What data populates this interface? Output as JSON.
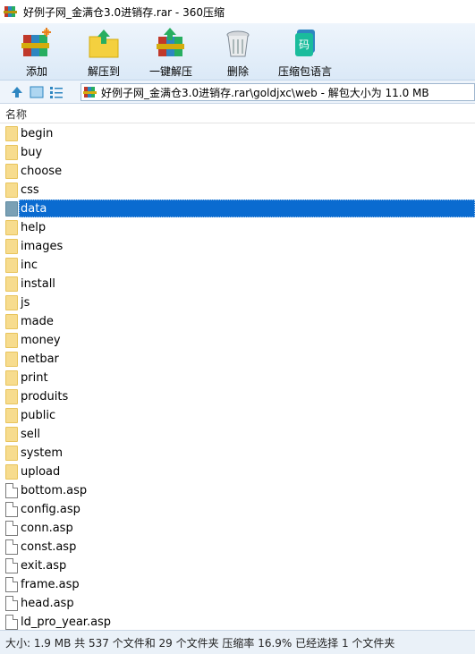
{
  "window": {
    "title": "好例子网_金满仓3.0进销存.rar - 360压缩"
  },
  "toolbar": {
    "buttons": [
      {
        "label": "添加",
        "icon": "add-archive-icon"
      },
      {
        "label": "解压到",
        "icon": "extract-to-icon"
      },
      {
        "label": "一键解压",
        "icon": "one-click-extract-icon"
      },
      {
        "label": "删除",
        "icon": "trash-icon"
      },
      {
        "label": "压缩包语言",
        "icon": "archive-language-icon"
      }
    ]
  },
  "address": {
    "path": "好例子网_金满仓3.0进销存.rar\\goldjxc\\web - 解包大小为 11.0 MB"
  },
  "list": {
    "column_name": "名称",
    "selected": "data",
    "items": [
      {
        "name": "begin",
        "type": "folder"
      },
      {
        "name": "buy",
        "type": "folder"
      },
      {
        "name": "choose",
        "type": "folder"
      },
      {
        "name": "css",
        "type": "folder"
      },
      {
        "name": "data",
        "type": "folder"
      },
      {
        "name": "help",
        "type": "folder"
      },
      {
        "name": "images",
        "type": "folder"
      },
      {
        "name": "inc",
        "type": "folder"
      },
      {
        "name": "install",
        "type": "folder"
      },
      {
        "name": "js",
        "type": "folder"
      },
      {
        "name": "made",
        "type": "folder"
      },
      {
        "name": "money",
        "type": "folder"
      },
      {
        "name": "netbar",
        "type": "folder"
      },
      {
        "name": "print",
        "type": "folder"
      },
      {
        "name": "produits",
        "type": "folder"
      },
      {
        "name": "public",
        "type": "folder"
      },
      {
        "name": "sell",
        "type": "folder"
      },
      {
        "name": "system",
        "type": "folder"
      },
      {
        "name": "upload",
        "type": "folder"
      },
      {
        "name": "bottom.asp",
        "type": "file"
      },
      {
        "name": "config.asp",
        "type": "file"
      },
      {
        "name": "conn.asp",
        "type": "file"
      },
      {
        "name": "const.asp",
        "type": "file"
      },
      {
        "name": "exit.asp",
        "type": "file"
      },
      {
        "name": "frame.asp",
        "type": "file"
      },
      {
        "name": "head.asp",
        "type": "file"
      },
      {
        "name": "ld_pro_year.asp",
        "type": "file"
      }
    ]
  },
  "status": {
    "text": "大小: 1.9 MB 共 537 个文件和 29 个文件夹 压缩率 16.9% 已经选择 1 个文件夹"
  }
}
